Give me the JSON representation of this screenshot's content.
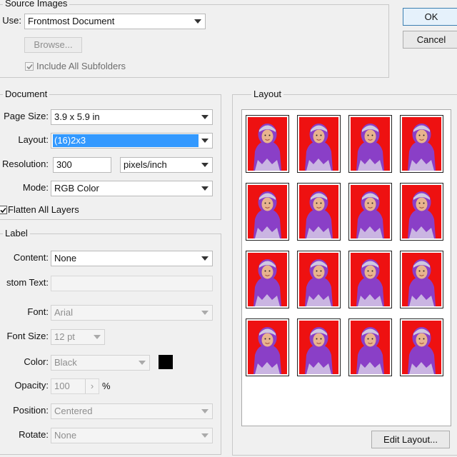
{
  "dialog": {
    "ok_label": "OK",
    "cancel_label": "Cancel"
  },
  "source_images": {
    "legend": "Source Images",
    "use_label": "Use:",
    "use_value": "Frontmost Document",
    "browse_label": "Browse...",
    "include_subfolders_label": "Include All Subfolders",
    "include_subfolders_checked": true
  },
  "document": {
    "legend": "Document",
    "page_size_label": "Page Size:",
    "page_size_value": "3.9 x 5.9 in",
    "layout_label": "Layout:",
    "layout_value": "(16)2x3",
    "resolution_label": "Resolution:",
    "resolution_value": "300",
    "resolution_unit": "pixels/inch",
    "mode_label": "Mode:",
    "mode_value": "RGB Color",
    "flatten_label": "Flatten All Layers",
    "flatten_checked": true
  },
  "label": {
    "legend": "Label",
    "content_label": "Content:",
    "content_value": "None",
    "custom_text_label": "stom Text:",
    "custom_text_value": "",
    "font_label": "Font:",
    "font_value": "Arial",
    "font_size_label": "Font Size:",
    "font_size_value": "12 pt",
    "color_label": "Color:",
    "color_value": "Black",
    "color_swatch": "#000000",
    "opacity_label": "Opacity:",
    "opacity_value": "100",
    "opacity_unit": "%",
    "position_label": "Position:",
    "position_value": "Centered",
    "rotate_label": "Rotate:",
    "rotate_value": "None"
  },
  "layout_preview": {
    "legend": "Layout",
    "edit_layout_label": "Edit Layout...",
    "rows": 4,
    "columns": 4,
    "photo_background": "#ee1111",
    "hijab_color": "#8a3fc7"
  }
}
